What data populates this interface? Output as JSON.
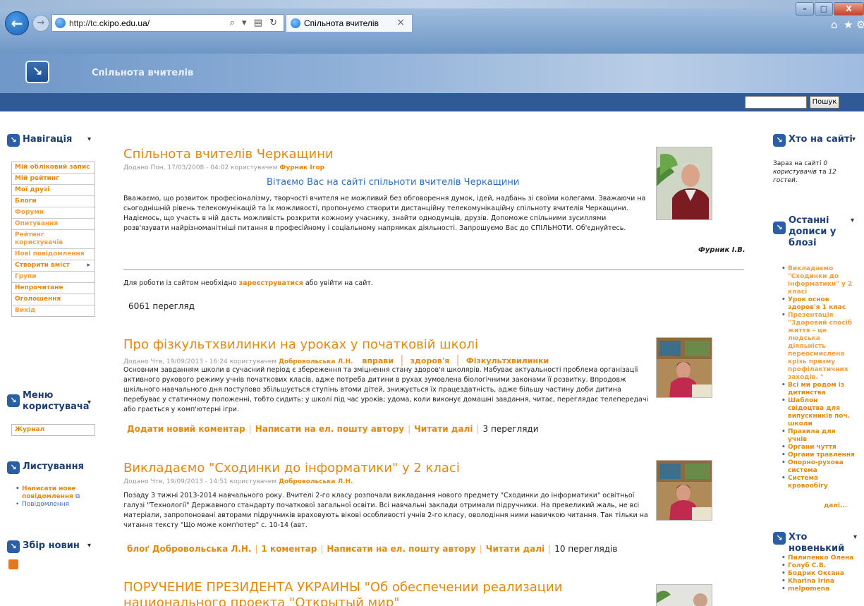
{
  "browser": {
    "url_prefix": "http://tc.",
    "url_host": "ckipo.edu.ua/",
    "addr_controls": "⌕ ▾ ▤ ↻",
    "tab_title": "Спільнота вчителів"
  },
  "site": {
    "name": "Спільнота вчителів",
    "search_button": "Пошук"
  },
  "nav": {
    "title": "Навігація",
    "items": [
      "Мій обліковий запис",
      "Мій рейтинг",
      "Мої друзі",
      "Блоги",
      "Форуми",
      "Опитування",
      "Рейтинг користувачів",
      "Нові повідомлення",
      "Створити вміст",
      "Групи",
      "Непрочитане",
      "Оголошення",
      "Вихід"
    ]
  },
  "user_menu": {
    "title": "Меню користувача",
    "items": [
      "Журнал"
    ]
  },
  "browsing": {
    "title": "Листування",
    "items": [
      "Написати нове повідомлення",
      "Повідомлення"
    ]
  },
  "news": {
    "title": "Збір новин"
  },
  "whos_online": {
    "title": "Хто на сайті",
    "text_before": "Зараз на сайті ",
    "users": "0 користувачів",
    "text_mid": " та ",
    "guests": "12 гостей",
    "text_end": "."
  },
  "recent_posts": {
    "title": "Останні дописи у блозі",
    "items": [
      "Викладаємо \"Сходинки до інформатики\" у 2 класі",
      "Урок основ здоров'я 1 клас",
      "Презентація \"Здоровий спосіб життя – це людська діяльність переосмислена крізь призму профілактичних заходів. \"",
      "Всі ми родом із дитинства",
      "Шаблон свідоцтва для випускників поч. школи",
      "Правила для учнів",
      "Органи чуття",
      "Органи травлення",
      "Опорно-рухова система",
      "Система кровообігу"
    ],
    "more": "далі..."
  },
  "whos_new": {
    "title": "Хто новенький",
    "items": [
      "Пилипенко Олена",
      "Голуб С.В.",
      "Бодрик Оксана",
      "Kharina Irina",
      "melpomena"
    ]
  },
  "intro": {
    "title": "Спільнота вчителів Черкащини",
    "meta_prefix": "Додано Пон, 17/03/2008 - 04:02 користувачем ",
    "meta_author": "Фурник Ігор",
    "heading": "Вітаємо Вас на сайті спільноти вчителів Черкащини",
    "body": "Вважаємо, що розвиток професіоналізму, творчості вчителя не можливий без обговорення думок, ідей, надбань зі своїми колегами. Зважаючи на сьогоднішній рівень телекомунікацій та їх можливості, пропонуємо створити дистанційну телекомунікаційну спільноту вчителів Черкащини. Надіємось, що участь в ній дасть можливість розкрити кожному учаснику, знайти однодумців, друзів. Допоможе спільними зусиллями розв'язувати найрізноманітніші питання в професійному і соціальному напрямках діяльності. Запрошуємо Вас до СПІЛЬНОТИ. Об'єднуйтесь.",
    "signature": "Фурник І.В.",
    "register_before": "Для роботи із сайтом необхідно ",
    "register_link": "зареєструватися",
    "register_after": " або увійти на сайт.",
    "views": "6061 перегляд"
  },
  "post1": {
    "title": "Про фізкультхвилинки на уроках у початковій школі",
    "meta_prefix": "Додано Чтв, 19/09/2013 - 16:24 користувачем ",
    "meta_author": "Добровольська Л.Н.",
    "tags": [
      "вправи",
      "здоров'я",
      "Фізкультхвилинки"
    ],
    "body": "Основним завданням школи в сучасний період є збереження та зміцнення стану здоров'я школярів. Набуває актуальності проблема організації активного рухового режиму учнів початкових класів, адже потреба дитини в рухах зумовлена біологічними законами її розвитку. Впродовж шкільного навчального дня поступово збільшується ступінь втоми дітей, знижується їх працездатність, адже більшу частину доби дитина перебуває у статичному положенні, тобто сидить: у школі під час уроків; удома, коли виконує домашні завдання, читає, переглядає телепередачі або грається у комп'ютерні ігри.",
    "links": [
      "Додати новий коментар",
      "Написати на ел. пошту автору",
      "Читати далі"
    ],
    "views": "3 перегляди"
  },
  "post2": {
    "title": "Викладаємо \"Сходинки до інформатики\" у 2 класі",
    "meta_prefix": "Додано Чтв, 19/09/2013 - 14:51 користувачем ",
    "meta_author": "Добровольська Л.Н.",
    "body": "Позаду 3 тижні 2013-2014 навчального року. Вчителі 2-го класу розпочали викладання нового предмету \"Сходинки до інформатики\" освітньої галузі \"Технології\" Державного стандарту початкової загальної освіти. Всі навчальні заклади отримали підручники. На превеликий жаль, не всі матеріали, запропоновані авторами підручників враховують вікові особливості учнів 2-го класу, оволодіння ними навичкою читання. Так тільки на читання тексту \"Що може комп'ютер\" с. 10-14 (авт.",
    "links": [
      "блоґ Добровольська Л.Н.",
      "1 коментар",
      "Написати на ел. пошту автору",
      "Читати далі"
    ],
    "views": "10 переглядів"
  },
  "post3": {
    "title": "ПОРУЧЕНИЕ ПРЕЗИДЕНТА УКРАИНЫ \"Об обеспечении реализации национального проекта \"Открытый мир\""
  }
}
